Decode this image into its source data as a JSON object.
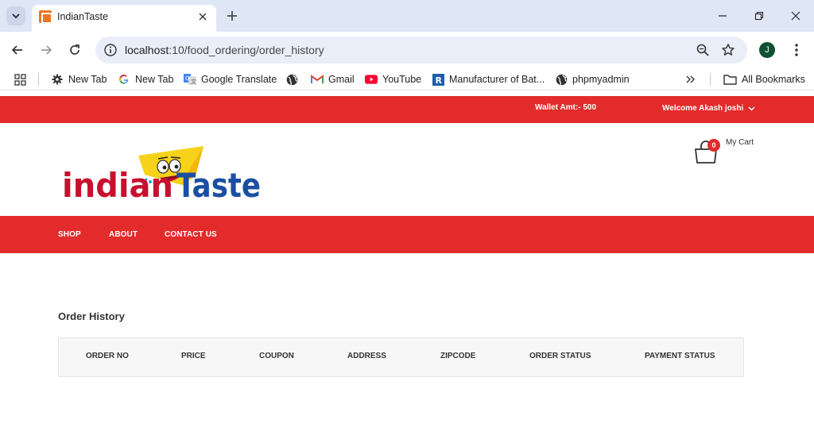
{
  "browser": {
    "tab_title": "IndianTaste",
    "url_host": "localhost",
    "url_path": ":10/food_ordering/order_history",
    "avatar_letter": "J",
    "bookmarks": [
      {
        "label": "New Tab",
        "icon": "gear-icon"
      },
      {
        "label": "New Tab",
        "icon": "google-icon"
      },
      {
        "label": "Google Translate",
        "icon": "translate-icon"
      },
      {
        "label": "",
        "icon": "globe-icon"
      },
      {
        "label": "Gmail",
        "icon": "gmail-icon"
      },
      {
        "label": "YouTube",
        "icon": "youtube-icon"
      },
      {
        "label": "Manufacturer of Bat...",
        "icon": "r-icon"
      },
      {
        "label": "phpmyadmin",
        "icon": "globe-icon"
      }
    ],
    "all_bookmarks": "All Bookmarks"
  },
  "topbar": {
    "wallet": "Wallet Amt:- 500",
    "welcome": "Welcome Akash joshi"
  },
  "header": {
    "logo_text_red": "indian",
    "logo_text_blue": "Taste",
    "cart_count": "0",
    "cart_label": "My Cart"
  },
  "nav": {
    "items": [
      "SHOP",
      "ABOUT",
      "CONTACT US"
    ]
  },
  "main": {
    "title": "Order History",
    "columns": [
      "ORDER NO",
      "PRICE",
      "COUPON",
      "ADDRESS",
      "ZIPCODE",
      "ORDER STATUS",
      "PAYMENT STATUS"
    ]
  },
  "colors": {
    "brand_red": "#e32b2b",
    "logo_blue": "#1a4fa3",
    "logo_yellow": "#f7d21a"
  }
}
